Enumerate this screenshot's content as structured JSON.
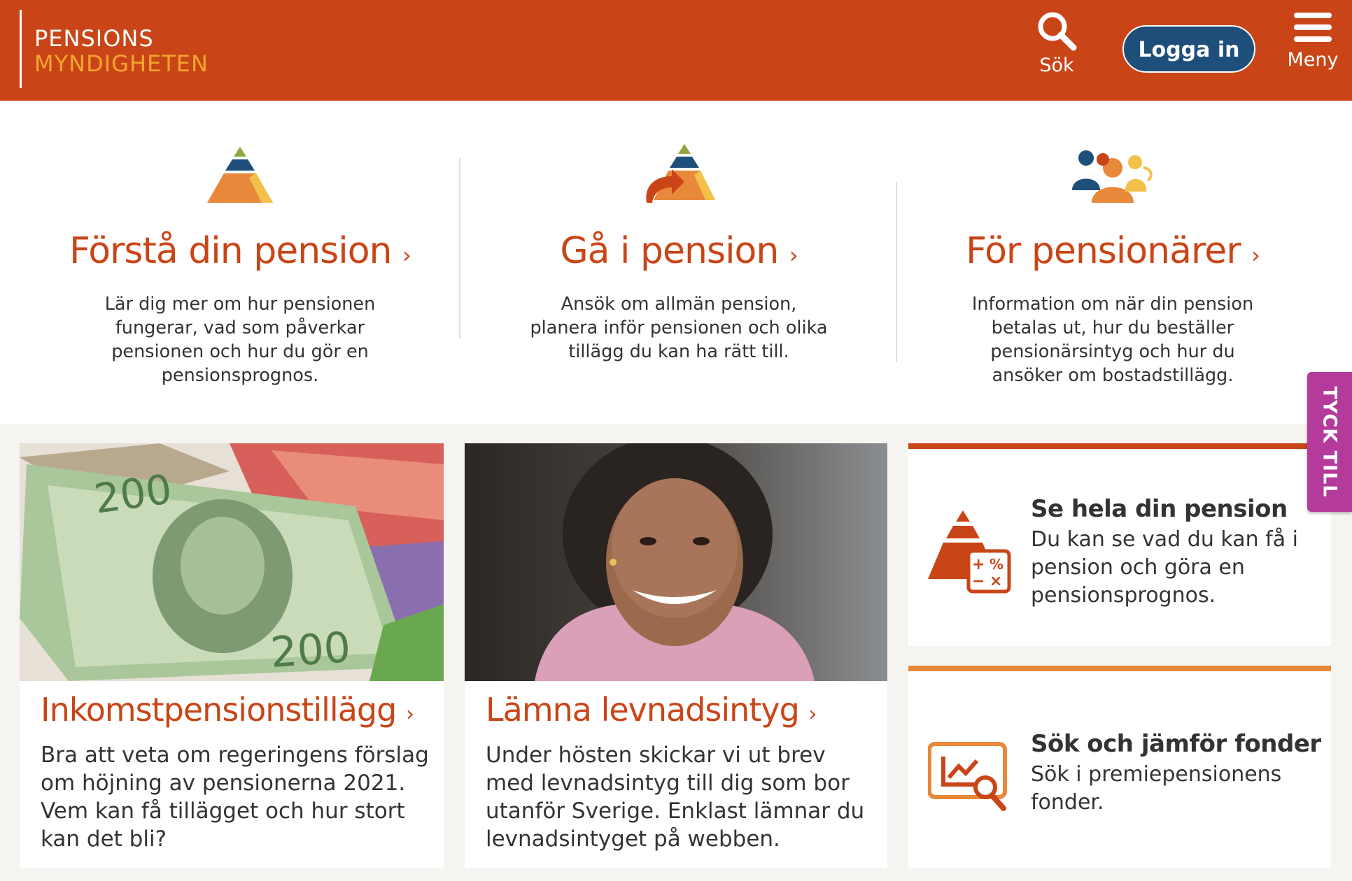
{
  "header": {
    "logo_line1": "PENSIONS",
    "logo_line2": "MYNDIGHETEN",
    "search_label": "Sök",
    "login_label": "Logga in",
    "menu_label": "Meny"
  },
  "colors": {
    "brand": "#c94517",
    "accent": "#f3a62e",
    "navy": "#1e4e7a",
    "feedback": "#b43a9c",
    "band": "#f5f4f1"
  },
  "intro": [
    {
      "title": "Förstå din pension",
      "chevron": "›",
      "icon": "pyramid-icon",
      "text": "Lär dig mer om hur pensionen fungerar, vad som påverkar pensionen och hur du gör en pensionsprognos."
    },
    {
      "title": "Gå i pension",
      "chevron": "›",
      "icon": "pyramid-arrow-icon",
      "text": "Ansök om allmän pension, planera inför pensionen och olika tillägg du kan ha rätt till."
    },
    {
      "title": "För pensionärer",
      "chevron": "›",
      "icon": "pensioners-group-icon",
      "text": "Information om när din pension betalas ut, hur du beställer pensionärsintyg och hur du ansöker om bostadstillägg."
    }
  ],
  "cards": [
    {
      "title": "Inkomstpensionstillägg",
      "chevron": "›",
      "image": "banknotes-photo",
      "text": "Bra att veta om regeringens förslag om höjning av pensionerna 2021. Vem kan få tillägget och hur stort kan det bli?"
    },
    {
      "title": "Lämna levnadsintyg",
      "chevron": "›",
      "image": "smiling-woman-photo",
      "text": "Under hösten skickar vi ut brev med levnadsintyg till dig som bor utanför Sverige. Enklast lämnar du levnadsintyget på webben."
    }
  ],
  "side_cards": [
    {
      "title": "Se hela din pension",
      "icon": "pyramid-calculator-icon",
      "text": "Du kan se vad du kan få i pension och göra en pensionsprognos."
    },
    {
      "title": "Sök och jämför fonder",
      "icon": "fund-chart-search-icon",
      "text": "Sök i premiepensionens fonder."
    }
  ],
  "feedback_tab": "TYCK TILL"
}
